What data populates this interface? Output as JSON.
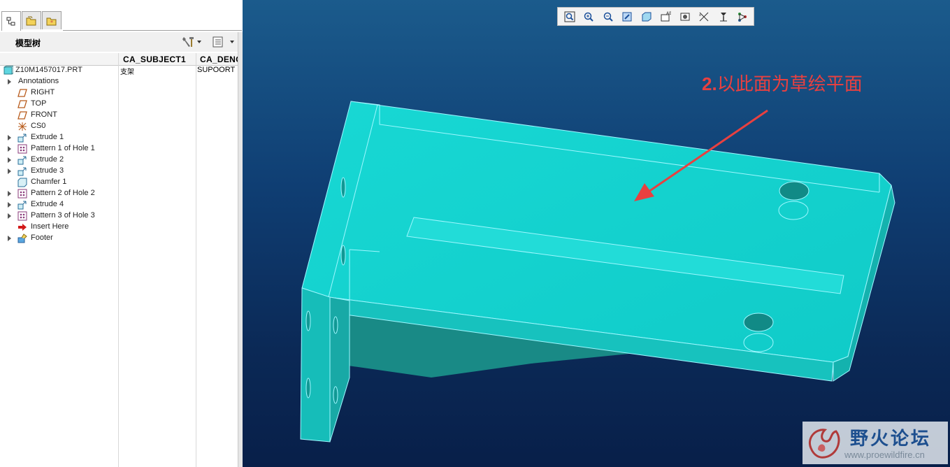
{
  "panel": {
    "title": "模型树"
  },
  "columns": {
    "col1": "CA_SUBJECT1",
    "col2": "CA_DENO"
  },
  "tree": [
    {
      "label": "Z10M1457017.PRT",
      "icon": "part-icon",
      "expandable": false,
      "col1": "支架",
      "col2": "SUPOORT"
    },
    {
      "label": "Annotations",
      "icon": "",
      "expandable": true
    },
    {
      "label": "RIGHT",
      "icon": "datum-plane-icon",
      "expandable": false
    },
    {
      "label": "TOP",
      "icon": "datum-plane-icon",
      "expandable": false
    },
    {
      "label": "FRONT",
      "icon": "datum-plane-icon",
      "expandable": false
    },
    {
      "label": "CS0",
      "icon": "coordinate-system-icon",
      "expandable": false
    },
    {
      "label": "Extrude 1",
      "icon": "extrude-icon",
      "expandable": true
    },
    {
      "label": "Pattern 1 of Hole 1",
      "icon": "pattern-icon",
      "expandable": true
    },
    {
      "label": "Extrude 2",
      "icon": "extrude-icon",
      "expandable": true
    },
    {
      "label": "Extrude 3",
      "icon": "extrude-icon",
      "expandable": true
    },
    {
      "label": "Chamfer 1",
      "icon": "chamfer-icon",
      "expandable": false
    },
    {
      "label": "Pattern 2 of Hole 2",
      "icon": "pattern-icon",
      "expandable": true
    },
    {
      "label": "Extrude 4",
      "icon": "extrude-icon",
      "expandable": true
    },
    {
      "label": "Pattern 3 of Hole 3",
      "icon": "pattern-icon",
      "expandable": true
    },
    {
      "label": "Insert Here",
      "icon": "insert-here-arrow-icon",
      "expandable": false
    },
    {
      "label": "Footer",
      "icon": "footer-icon",
      "expandable": true
    }
  ],
  "toolbar_icons": [
    "refit-icon",
    "zoom-in-icon",
    "zoom-out-icon",
    "repaint-icon",
    "display-style-icon",
    "saved-views-icon",
    "view-manager-icon",
    "datum-display-icon",
    "spin-center-icon",
    "annotation-display-icon"
  ],
  "annotation": {
    "num": "2.",
    "text": "以此面为草绘平面"
  },
  "watermark": {
    "title": "野火论坛",
    "url": "www.proewildfire.cn"
  },
  "colors": {
    "model_face": "#14d4d0",
    "model_edge": "#9ff7ff",
    "annotation": "#e84040",
    "viewport_top": "#1b5b8c",
    "viewport_bottom": "#081f49"
  }
}
